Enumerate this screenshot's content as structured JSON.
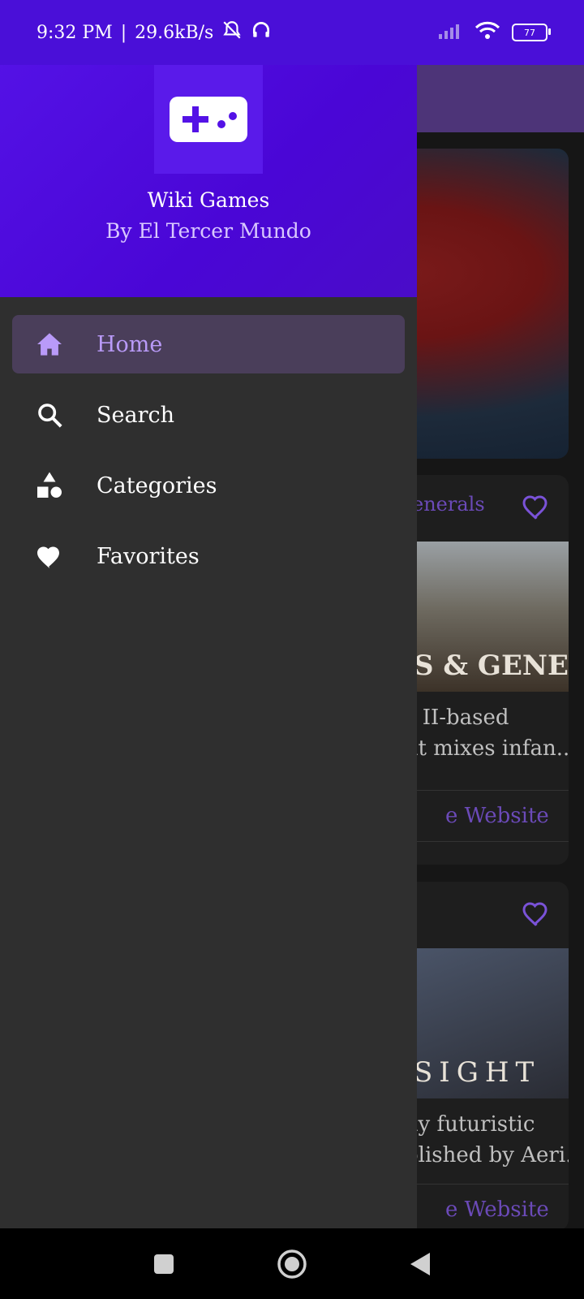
{
  "status_bar": {
    "time": "9:32 PM",
    "speed": "29.6kB/s",
    "signal": "4G",
    "battery": "77"
  },
  "drawer": {
    "app_title": "Wiki Games",
    "app_subtitle": "By El Tercer Mundo",
    "items": [
      {
        "label": "Home",
        "icon": "home-icon",
        "active": true
      },
      {
        "label": "Search",
        "icon": "search-icon",
        "active": false
      },
      {
        "label": "Categories",
        "icon": "categories-icon",
        "active": false
      },
      {
        "label": "Favorites",
        "icon": "heart-icon",
        "active": false
      }
    ]
  },
  "background": {
    "card2": {
      "title": "enerals",
      "photo_caption": "S & GENERALS",
      "desc_line1": "r II-based",
      "desc_line2": "at mixes infan...",
      "button": "e Website"
    },
    "card3": {
      "photo_caption": "SIGHT",
      "desc_line1": "ay futuristic",
      "desc_line2": "olished by Aeri...",
      "button": "e Website"
    }
  },
  "colors": {
    "accent": "#b99af8",
    "header": "#4a06d6",
    "drawer_bg": "#2f2f2f"
  }
}
